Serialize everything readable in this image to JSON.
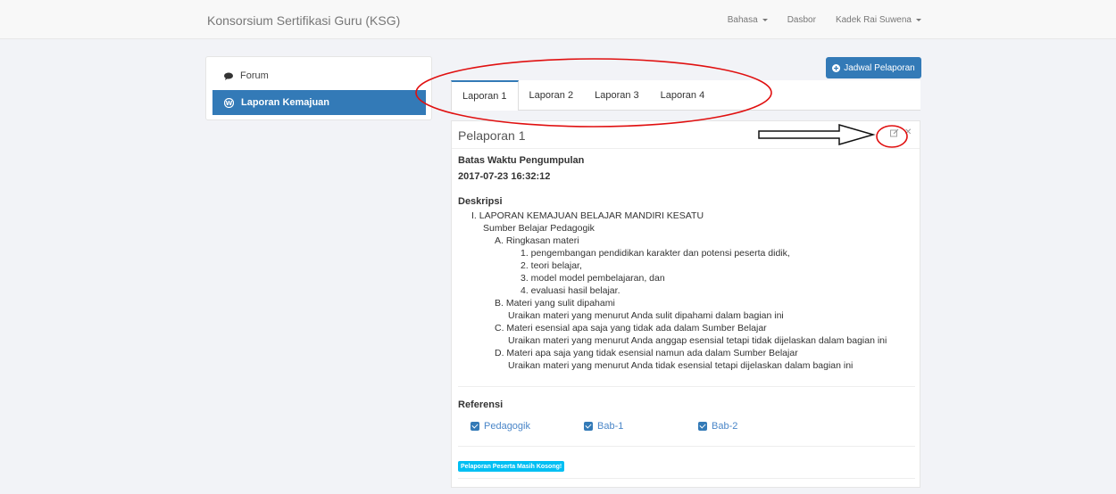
{
  "navbar": {
    "brand": "Konsorsium Sertifikasi Guru (KSG)",
    "language": "Bahasa",
    "dashboard": "Dasbor",
    "user": "Kadek Rai Suwena"
  },
  "sidebar": {
    "items": [
      {
        "label": "Forum",
        "icon": "comment-icon"
      },
      {
        "label": "Laporan Kemajuan",
        "icon": "wordpress-icon"
      }
    ]
  },
  "toolbar": {
    "schedule_label": "Jadwal Pelaporan"
  },
  "tabs": [
    "Laporan 1",
    "Laporan 2",
    "Laporan 3",
    "Laporan 4"
  ],
  "panel": {
    "title": "Pelaporan 1",
    "deadline_label": "Batas Waktu Pengumpulan",
    "deadline_value": "2017-07-23 16:32:12",
    "description_label": "Deskripsi",
    "description": {
      "heading": "I.  LAPORAN KEMAJUAN BELAJAR MANDIRI KESATU",
      "source": "Sumber Belajar Pedagogik",
      "a": "A.  Ringkasan materi",
      "a_items": [
        "1.  pengembangan pendidikan karakter dan potensi peserta didik,",
        "2.  teori belajar,",
        "3.  model model pembelajaran, dan",
        "4.  evaluasi hasil belajar."
      ],
      "b": "B.  Materi yang sulit dipahami",
      "b_text": "Uraikan materi yang menurut Anda sulit dipahami dalam bagian ini",
      "c": "C.  Materi esensial apa saja yang tidak ada dalam Sumber Belajar",
      "c_text": "Uraikan materi yang menurut Anda anggap esensial tetapi tidak dijelaskan dalam bagian ini",
      "d": "D.  Materi apa saja yang tidak esensial namun ada dalam Sumber Belajar",
      "d_text": "Uraikan materi yang menurut Anda tidak esensial tetapi dijelaskan dalam bagian ini"
    },
    "reference_label": "Referensi",
    "references": [
      "Pedagogik",
      "Bab-1",
      "Bab-2"
    ],
    "status_badge": "Pelaporan Peserta Masih Kosong!"
  },
  "colors": {
    "primary": "#337ab7",
    "badge": "#00bff3",
    "annotation": "#e01010"
  }
}
